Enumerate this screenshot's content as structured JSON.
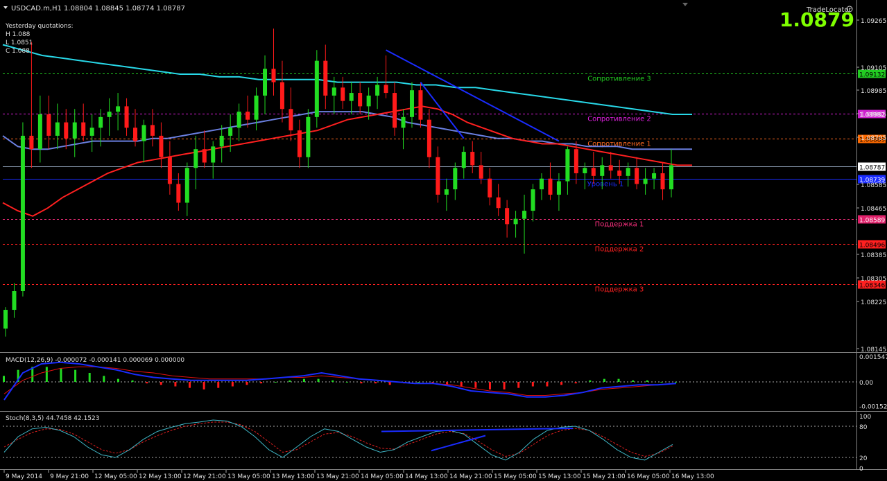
{
  "window": {
    "header": "USDCAD.m,H1  1.08804 1.08845 1.08774 1.08787",
    "indicator_name": "TradeLocator",
    "big_price": "1.0879",
    "yesterday": {
      "title": "Yesterday quotations:",
      "high": "H 1.088",
      "low": "L 1.0851",
      "close": "C 1.088"
    }
  },
  "colors": {
    "bull": "#22dd22",
    "bear": "#ff1a1a",
    "ma_fast": "#ff2020",
    "ma_slow": "#6a7fe0",
    "ma_long": "#28d8e8",
    "trendline": "#1a2cff",
    "big_price": "#7fff00",
    "macd_line": "#1a2cff",
    "macd_signal": "#e01010",
    "stoch_main": "#3fb7c7",
    "stoch_signal": "#e02020"
  },
  "chart_data": [
    {
      "type": "candlestick",
      "title": "USDCAD.m,H1",
      "ylim": [
        1.081,
        1.0935
      ],
      "y_ticks": [
        "1.09265",
        "1.09105",
        "1.08985",
        "1.08865",
        "1.08705",
        "1.08585",
        "1.08465",
        "1.08385",
        "1.08305",
        "1.08225",
        "1.08145"
      ],
      "x_ticks": [
        "9 May 2014",
        "9 May 21:00",
        "12 May 05:00",
        "12 May 13:00",
        "12 May 21:00",
        "13 May 05:00",
        "13 May 13:00",
        "13 May 21:00",
        "14 May 05:00",
        "14 May 13:00",
        "14 May 21:00",
        "15 May 05:00",
        "15 May 13:00",
        "15 May 21:00",
        "16 May 05:00",
        "16 May 13:00"
      ],
      "levels": [
        {
          "name": "Сопротивление 3",
          "value": 1.09132,
          "tag": "1.09132",
          "color": "#22cc22",
          "tagbg": "#22cc22",
          "tagfg": "#000"
        },
        {
          "name": "Сопротивление 2",
          "value": 1.08982,
          "tag": "1.08982",
          "color": "#e020e0",
          "tagbg": "#d020d0",
          "tagfg": "#fff"
        },
        {
          "name": "Сопротивление 1",
          "value": 1.08889,
          "tag": "1.08889",
          "color": "#ff6a20",
          "tagbg": "#ff6a00",
          "tagfg": "#000"
        },
        {
          "name": "Уровень 1",
          "value": 1.0874,
          "tag": "1.08739",
          "color": "#1a2cff",
          "tagbg": "#1a2cff",
          "tagfg": "#fff"
        },
        {
          "name": "Поддержка 1",
          "value": 1.08589,
          "tag": "1.08589",
          "color": "#ff3080",
          "tagbg": "#e0206a",
          "tagfg": "#fff"
        },
        {
          "name": "Поддержка 2",
          "value": 1.08496,
          "tag": "1.08496",
          "color": "#ff2020",
          "tagbg": "#ff2020",
          "tagfg": "#000"
        },
        {
          "name": "Поддержка 3",
          "value": 1.08346,
          "tag": "1.08346",
          "color": "#ff2020",
          "tagbg": "#ff2020",
          "tagfg": "#000"
        }
      ],
      "current_price": {
        "value": 1.08787,
        "tag": "1.08787"
      },
      "candles": [
        [
          1.0818,
          1.0826,
          1.0815,
          1.0825
        ],
        [
          1.0825,
          1.0835,
          1.0822,
          1.0832
        ],
        [
          1.0832,
          1.0895,
          1.083,
          1.089
        ],
        [
          1.089,
          1.0925,
          1.0878,
          1.0885
        ],
        [
          1.0885,
          1.0905,
          1.088,
          1.0898
        ],
        [
          1.0898,
          1.0905,
          1.0885,
          1.089
        ],
        [
          1.089,
          1.0902,
          1.0885,
          1.0895
        ],
        [
          1.0895,
          1.09,
          1.0885,
          1.0889
        ],
        [
          1.0889,
          1.09,
          1.0882,
          1.0895
        ],
        [
          1.0895,
          1.0902,
          1.0888,
          1.089
        ],
        [
          1.089,
          1.0898,
          1.0884,
          1.0893
        ],
        [
          1.0893,
          1.09,
          1.0886,
          1.0897
        ],
        [
          1.0897,
          1.0904,
          1.089,
          1.0899
        ],
        [
          1.0899,
          1.0906,
          1.0892,
          1.0901
        ],
        [
          1.0901,
          1.0904,
          1.089,
          1.0893
        ],
        [
          1.0893,
          1.09,
          1.0886,
          1.0888
        ],
        [
          1.0888,
          1.0896,
          1.088,
          1.0894
        ],
        [
          1.0894,
          1.09,
          1.0886,
          1.089
        ],
        [
          1.089,
          1.0895,
          1.0878,
          1.0882
        ],
        [
          1.0882,
          1.0888,
          1.0868,
          1.0872
        ],
        [
          1.0872,
          1.0876,
          1.0862,
          1.0865
        ],
        [
          1.0865,
          1.088,
          1.086,
          1.0878
        ],
        [
          1.0878,
          1.089,
          1.087,
          1.0885
        ],
        [
          1.0885,
          1.0892,
          1.0878,
          1.088
        ],
        [
          1.088,
          1.0888,
          1.0874,
          1.0886
        ],
        [
          1.0886,
          1.0894,
          1.088,
          1.089
        ],
        [
          1.089,
          1.0898,
          1.0884,
          1.0893
        ],
        [
          1.0893,
          1.0902,
          1.0888,
          1.0899
        ],
        [
          1.0899,
          1.0905,
          1.0893,
          1.0896
        ],
        [
          1.0896,
          1.0908,
          1.0892,
          1.0905
        ],
        [
          1.0905,
          1.092,
          1.0898,
          1.0915
        ],
        [
          1.0915,
          1.093,
          1.0905,
          1.091
        ],
        [
          1.091,
          1.0918,
          1.0895,
          1.09
        ],
        [
          1.09,
          1.0908,
          1.0888,
          1.0892
        ],
        [
          1.0892,
          1.0896,
          1.0878,
          1.0882
        ],
        [
          1.0882,
          1.09,
          1.0878,
          1.0897
        ],
        [
          1.0897,
          1.0922,
          1.0893,
          1.0918
        ],
        [
          1.0918,
          1.0924,
          1.09,
          1.0905
        ],
        [
          1.0905,
          1.0912,
          1.0898,
          1.0908
        ],
        [
          1.0908,
          1.0912,
          1.09,
          1.0903
        ],
        [
          1.0903,
          1.091,
          1.0898,
          1.0906
        ],
        [
          1.0906,
          1.091,
          1.0898,
          1.0901
        ],
        [
          1.0901,
          1.0908,
          1.0896,
          1.0905
        ],
        [
          1.0905,
          1.0912,
          1.09,
          1.0909
        ],
        [
          1.0909,
          1.092,
          1.0904,
          1.0906
        ],
        [
          1.0906,
          1.091,
          1.089,
          1.0893
        ],
        [
          1.0893,
          1.09,
          1.0885,
          1.0897
        ],
        [
          1.0897,
          1.091,
          1.0893,
          1.0907
        ],
        [
          1.0907,
          1.091,
          1.0893,
          1.0896
        ],
        [
          1.0896,
          1.09,
          1.0878,
          1.0882
        ],
        [
          1.0882,
          1.0886,
          1.0865,
          1.0868
        ],
        [
          1.0868,
          1.0874,
          1.0862,
          1.087
        ],
        [
          1.087,
          1.088,
          1.0866,
          1.0878
        ],
        [
          1.0878,
          1.0886,
          1.0874,
          1.0884
        ],
        [
          1.0884,
          1.0888,
          1.0876,
          1.0879
        ],
        [
          1.0879,
          1.0884,
          1.0872,
          1.0874
        ],
        [
          1.0874,
          1.0878,
          1.0864,
          1.0867
        ],
        [
          1.0867,
          1.0872,
          1.086,
          1.0863
        ],
        [
          1.0863,
          1.0866,
          1.0852,
          1.0857
        ],
        [
          1.0857,
          1.0862,
          1.0852,
          1.0859
        ],
        [
          1.0859,
          1.0868,
          1.0846,
          1.0862
        ],
        [
          1.0862,
          1.0872,
          1.0858,
          1.087
        ],
        [
          1.087,
          1.0876,
          1.0866,
          1.0874
        ],
        [
          1.0874,
          1.088,
          1.0866,
          1.0868
        ],
        [
          1.0868,
          1.0876,
          1.0862,
          1.0873
        ],
        [
          1.0873,
          1.0886,
          1.0868,
          1.0885
        ],
        [
          1.0885,
          1.0888,
          1.0872,
          1.0876
        ],
        [
          1.0876,
          1.088,
          1.087,
          1.0878
        ],
        [
          1.0878,
          1.0884,
          1.0872,
          1.0875
        ],
        [
          1.0875,
          1.0882,
          1.087,
          1.0879
        ],
        [
          1.0879,
          1.0884,
          1.0874,
          1.0877
        ],
        [
          1.0877,
          1.0881,
          1.0872,
          1.0875
        ],
        [
          1.0875,
          1.088,
          1.0871,
          1.0878
        ],
        [
          1.0878,
          1.0882,
          1.087,
          1.0872
        ],
        [
          1.0872,
          1.0878,
          1.0868,
          1.0874
        ],
        [
          1.0874,
          1.0878,
          1.087,
          1.0876
        ],
        [
          1.0876,
          1.088,
          1.0866,
          1.087
        ],
        [
          1.087,
          1.0885,
          1.0867,
          1.0879
        ]
      ],
      "ma_fast": [
        1.0865,
        1.0862,
        1.086,
        1.0863,
        1.0867,
        1.087,
        1.0873,
        1.0876,
        1.0878,
        1.088,
        1.0881,
        1.0882,
        1.0883,
        1.0884,
        1.0885,
        1.0886,
        1.0887,
        1.0888,
        1.0889,
        1.089,
        1.0891,
        1.0892,
        1.0894,
        1.0896,
        1.0897,
        1.0898,
        1.0899,
        1.09,
        1.0901,
        1.09,
        1.0898,
        1.0895,
        1.0893,
        1.0891,
        1.0889,
        1.0888,
        1.0887,
        1.0887,
        1.0886,
        1.0885,
        1.0884,
        1.0883,
        1.0882,
        1.0881,
        1.088,
        1.0879,
        1.0879
      ],
      "ma_slow": [
        1.089,
        1.0886,
        1.0885,
        1.0885,
        1.0886,
        1.0887,
        1.0888,
        1.0888,
        1.0888,
        1.0888,
        1.0889,
        1.0889,
        1.089,
        1.0891,
        1.0892,
        1.0893,
        1.0894,
        1.0895,
        1.0896,
        1.0897,
        1.0898,
        1.0899,
        1.0899,
        1.0899,
        1.0899,
        1.0898,
        1.0897,
        1.0895,
        1.0894,
        1.0893,
        1.0892,
        1.0891,
        1.089,
        1.0889,
        1.0889,
        1.0888,
        1.0888,
        1.0887,
        1.0887,
        1.0886,
        1.0886,
        1.0886,
        1.0885,
        1.0885,
        1.0885,
        1.0885,
        1.0885
      ],
      "ma_long": [
        1.0924,
        1.0922,
        1.092,
        1.0919,
        1.0918,
        1.0917,
        1.0916,
        1.0915,
        1.0914,
        1.0913,
        1.0913,
        1.0912,
        1.0912,
        1.0911,
        1.0911,
        1.0911,
        1.0911,
        1.091,
        1.091,
        1.091,
        1.091,
        1.0909,
        1.0909,
        1.0908,
        1.0908,
        1.0907,
        1.0906,
        1.0905,
        1.0904,
        1.0903,
        1.0902,
        1.0901,
        1.09,
        1.0899,
        1.0898,
        1.0898
      ],
      "trendlines": [
        {
          "from": [
            44,
            1.0922
          ],
          "to": [
            64,
            1.0888
          ]
        },
        {
          "from": [
            48,
            1.091
          ],
          "to": [
            53,
            1.0889
          ]
        }
      ]
    },
    {
      "type": "histogram+line",
      "title": "MACD(12,26,9) -0.000072 -0.000141 0.000069 0.000000",
      "y_ticks": [
        "0.001547",
        "0.00",
        "-0.001521"
      ],
      "ylim": [
        -0.0018,
        0.0018
      ],
      "histogram": [
        0.0004,
        0.0008,
        0.001,
        0.001,
        0.0009,
        0.0008,
        0.0006,
        0.0004,
        0.0002,
        0.0001,
        -0.0001,
        -0.0002,
        -0.0003,
        -0.0004,
        -0.0005,
        -0.0004,
        -0.0003,
        -0.0002,
        -0.0001,
        0.0,
        0.0001,
        0.0002,
        0.0002,
        0.0001,
        0.0,
        -0.0001,
        -0.0001,
        -0.0002,
        -0.0001,
        0.0,
        -0.0001,
        -0.0002,
        -0.0003,
        -0.0004,
        -0.0005,
        -0.0005,
        -0.0004,
        -0.0003,
        -0.0003,
        -0.0002,
        -0.0001,
        0.0001,
        0.0002,
        0.0002,
        0.0001,
        0.0001,
        0.0,
        0.0
      ],
      "macd": [
        -0.0012,
        0.0006,
        0.0012,
        0.0013,
        0.0012,
        0.001,
        0.0008,
        0.0005,
        0.0003,
        0.0002,
        0.0001,
        0.0001,
        0.0001,
        0.0001,
        0.0002,
        0.0003,
        0.0004,
        0.0006,
        0.0004,
        0.0002,
        0.0001,
        0.0,
        -0.0001,
        -0.0001,
        -0.0003,
        -0.0006,
        -0.0007,
        -0.0008,
        -0.001,
        -0.001,
        -0.0009,
        -0.0007,
        -0.0004,
        -0.0003,
        -0.0002,
        -0.0002,
        -0.0001
      ],
      "signal": [
        -0.0008,
        0.0001,
        0.0006,
        0.0009,
        0.001,
        0.001,
        0.0009,
        0.0007,
        0.0006,
        0.0004,
        0.0003,
        0.0002,
        0.0002,
        0.0002,
        0.0002,
        0.0003,
        0.0003,
        0.0004,
        0.0003,
        0.0002,
        0.0001,
        0.0,
        -0.0001,
        -0.0001,
        -0.0002,
        -0.0004,
        -0.0006,
        -0.0007,
        -0.0009,
        -0.0009,
        -0.0008,
        -0.0007,
        -0.0005,
        -0.0004,
        -0.0003,
        -0.0002,
        -0.0001
      ]
    },
    {
      "type": "line",
      "title": "Stoch(8,3,5) 44.7458 42.1523",
      "y_ticks": [
        "100",
        "80",
        "20",
        "0"
      ],
      "ylim": [
        0,
        100
      ],
      "main": [
        30,
        60,
        75,
        78,
        72,
        60,
        40,
        25,
        20,
        35,
        55,
        70,
        78,
        85,
        88,
        92,
        90,
        80,
        60,
        35,
        20,
        40,
        60,
        75,
        70,
        55,
        40,
        30,
        35,
        50,
        60,
        70,
        72,
        65,
        45,
        25,
        15,
        30,
        55,
        72,
        78,
        80,
        72,
        55,
        35,
        20,
        15,
        30,
        45
      ],
      "signal": [
        40,
        55,
        68,
        75,
        74,
        65,
        50,
        35,
        28,
        35,
        50,
        62,
        72,
        80,
        85,
        88,
        88,
        83,
        70,
        50,
        30,
        35,
        50,
        65,
        68,
        60,
        48,
        38,
        36,
        45,
        55,
        65,
        70,
        66,
        52,
        35,
        22,
        28,
        45,
        62,
        72,
        76,
        72,
        60,
        45,
        30,
        22,
        28,
        42
      ]
    }
  ]
}
